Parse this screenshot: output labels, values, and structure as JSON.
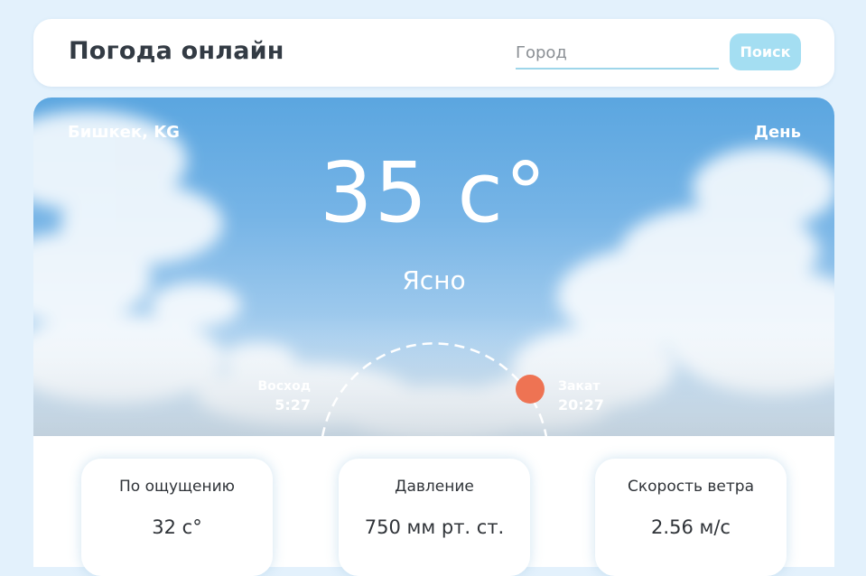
{
  "header": {
    "title": "Погода онлайн",
    "city_placeholder": "Город",
    "city_value": "",
    "search_label": "Поиск"
  },
  "weather": {
    "location": "Бишкек, KG",
    "daytime": "День",
    "temperature": "35 с°",
    "condition": "Ясно",
    "sunrise_label": "Восход",
    "sunrise_time": "5:27",
    "sunset_label": "Закат",
    "sunset_time": "20:27",
    "sun_progress_fraction": 0.83
  },
  "stats": [
    {
      "label": "По ощущению",
      "value": "32 с°"
    },
    {
      "label": "Давление",
      "value": "750 мм рт. ст."
    },
    {
      "label": "Скорость ветра",
      "value": "2.56 м/с"
    }
  ],
  "colors": {
    "page_background": "#e3f1fc",
    "search_button": "#a4def2",
    "input_underline": "#9ed6ea",
    "sun": "#ee7353",
    "text_dark": "#333b44"
  },
  "icons": {
    "sun_marker": "sun-icon",
    "sun_path": "sun-path-arc"
  }
}
